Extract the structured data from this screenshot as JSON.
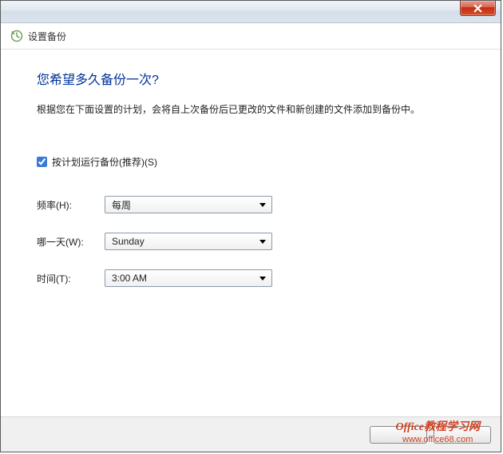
{
  "window": {
    "title": "设置备份"
  },
  "heading": "您希望多久备份一次?",
  "description": "根据您在下面设置的计划，会将自上次备份后已更改的文件和新创建的文件添加到备份中。",
  "checkbox": {
    "label": "按计划运行备份(推荐)(S)",
    "checked": true
  },
  "fields": {
    "frequency": {
      "label": "频率(H):",
      "value": "每周"
    },
    "day": {
      "label": "哪一天(W):",
      "value": "Sunday"
    },
    "time": {
      "label": "时间(T):",
      "value": "3:00 AM"
    }
  },
  "buttons": {
    "ok": "",
    "cancel": ""
  },
  "watermark": {
    "line1": "Office教程学习网",
    "line2": "www.office68.com"
  }
}
